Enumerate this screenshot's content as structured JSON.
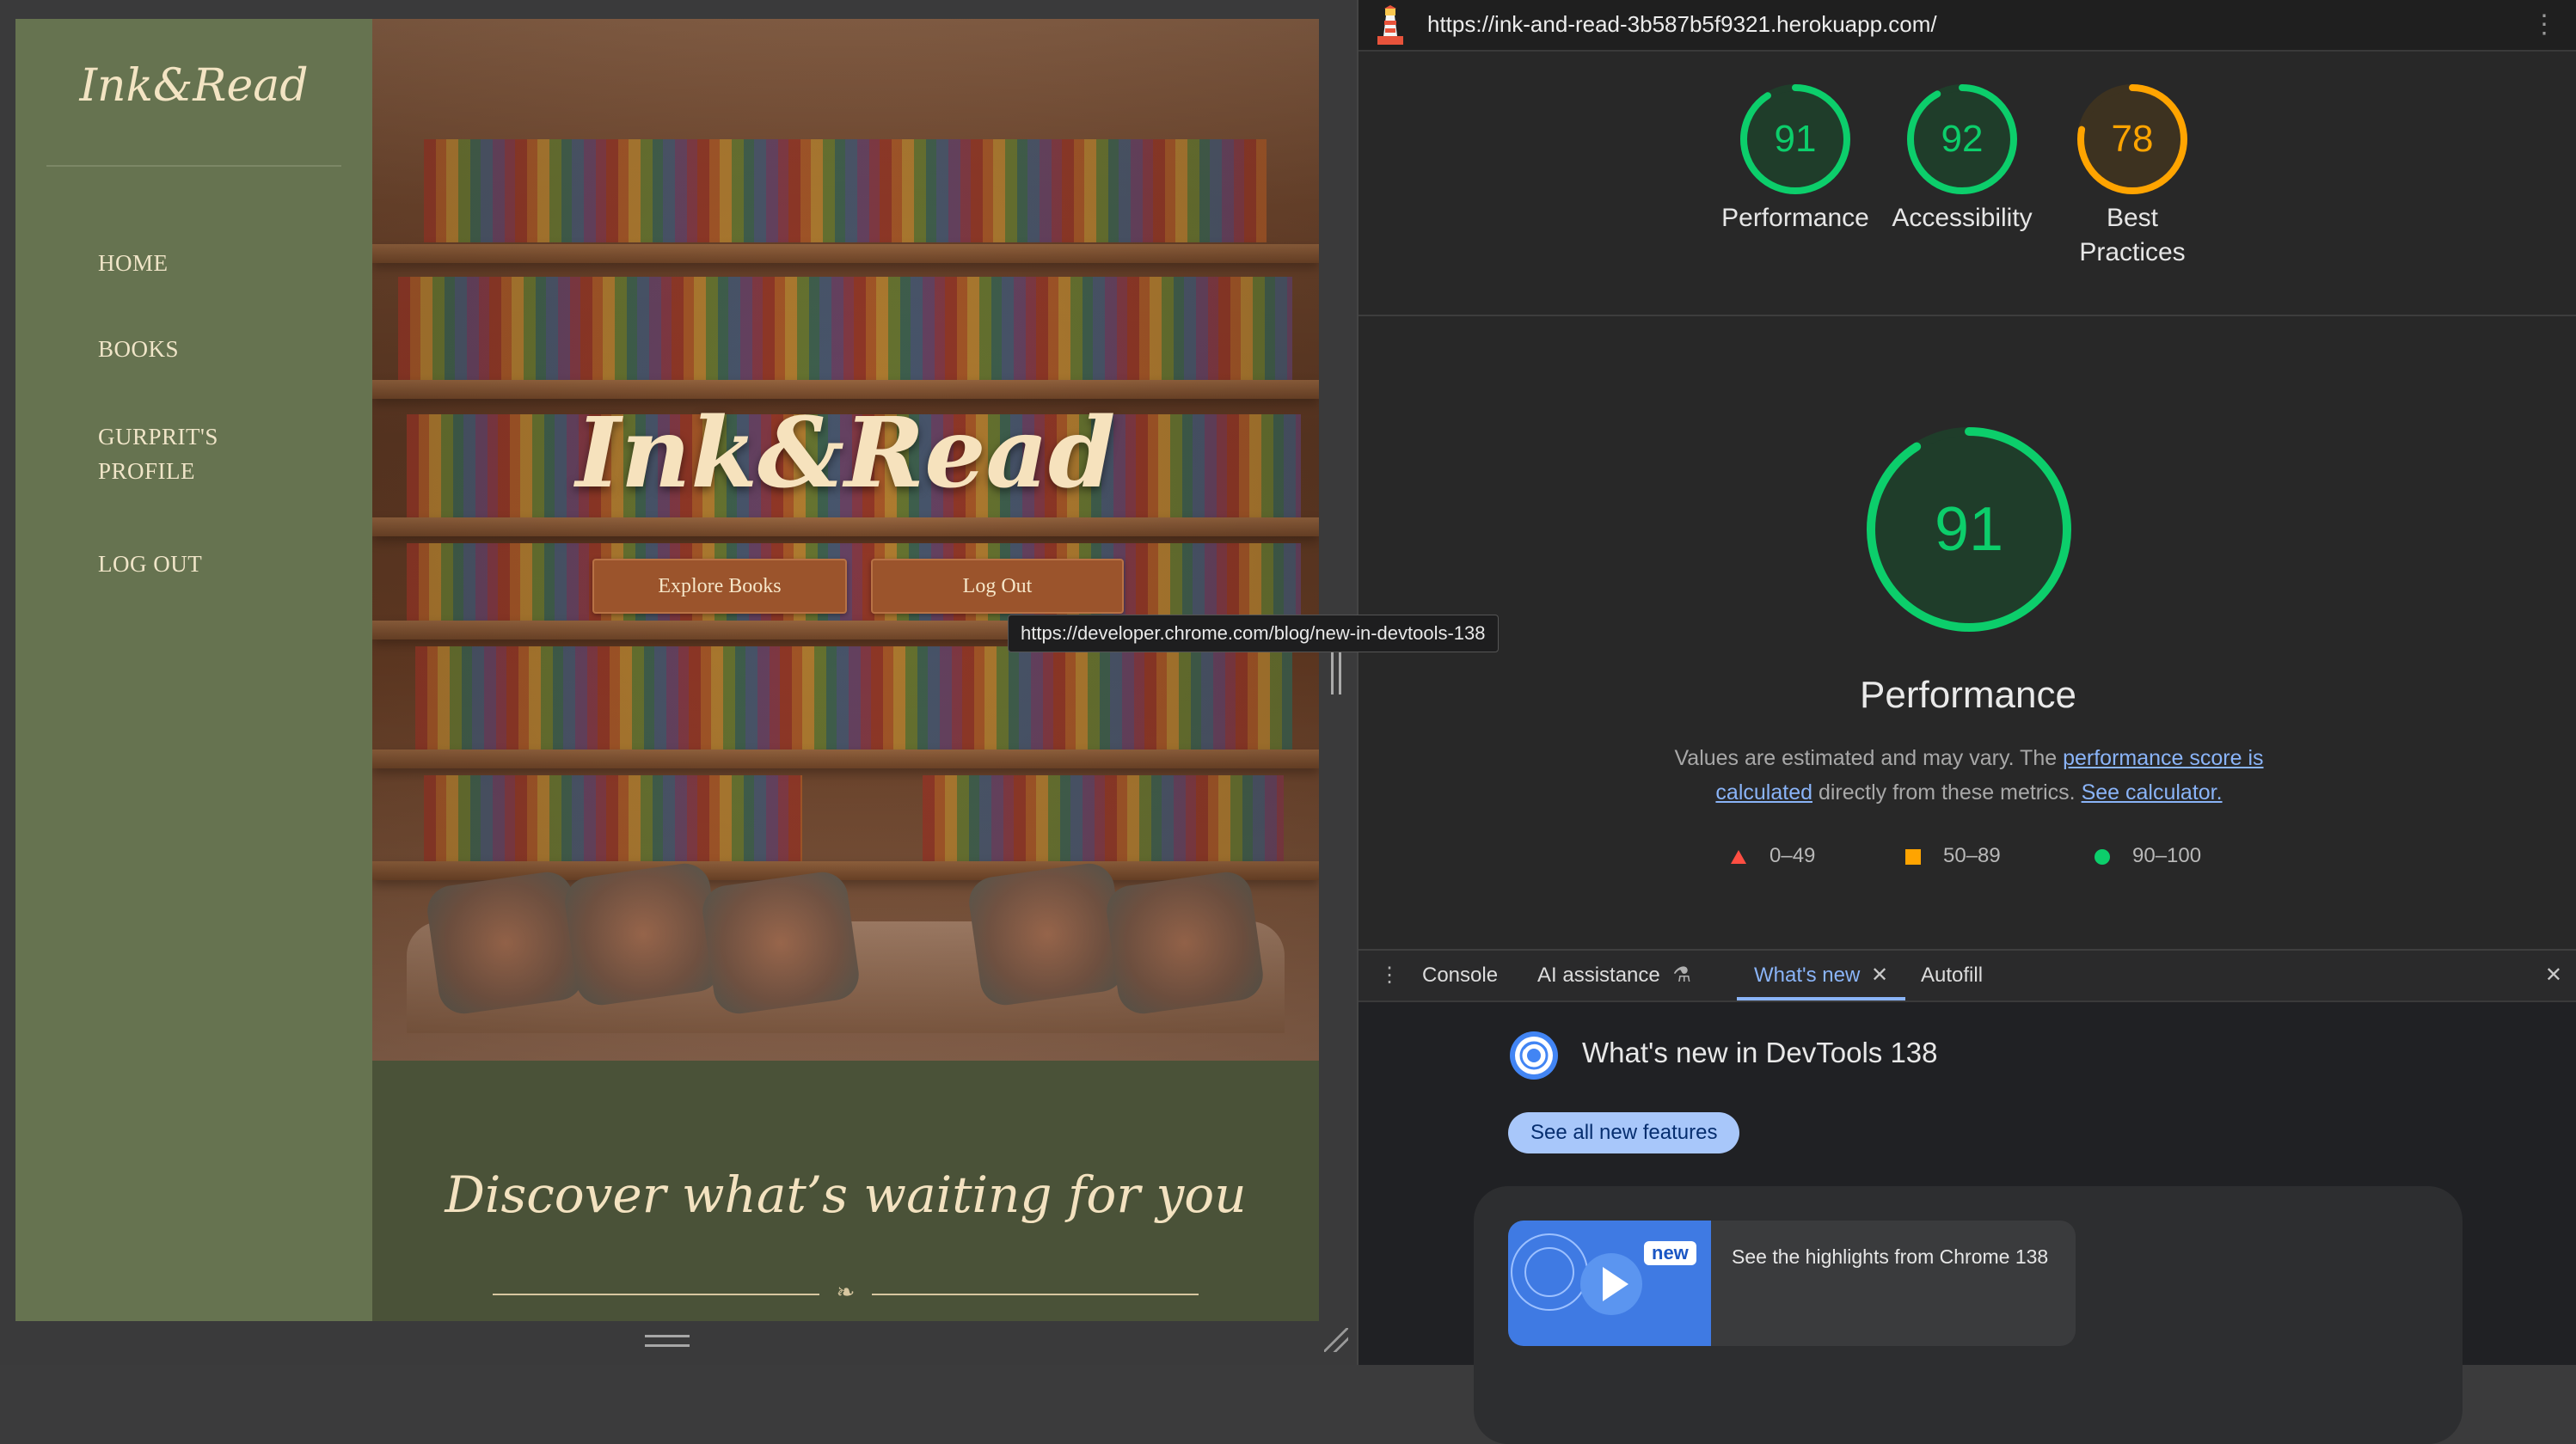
{
  "site": {
    "logo": "Ink&Read",
    "nav": [
      {
        "label": "HOME"
      },
      {
        "label": "BOOKS"
      },
      {
        "label": "GURPRIT'S",
        "label2": "PROFILE"
      },
      {
        "label": "LOG OUT"
      }
    ],
    "hero_title": "Ink&Read",
    "buttons": {
      "explore": "Explore Books",
      "logout": "Log Out"
    },
    "discover_title": "Discover what’s waiting for you",
    "ornament": "❧"
  },
  "tooltip": "https://developer.chrome.com/blog/new-in-devtools-138",
  "lighthouse": {
    "url": "https://ink-and-read-3b587b5f9321.herokuapp.com/",
    "menu_icon": "⋮",
    "scores": [
      {
        "label": "Performance",
        "value": "91",
        "score": 91,
        "color": "#0cce6b"
      },
      {
        "label": "Accessibility",
        "value": "92",
        "score": 92,
        "color": "#0cce6b"
      },
      {
        "label": "Best Practices",
        "value": "78",
        "score": 78,
        "color": "#ffa400"
      }
    ],
    "main": {
      "value": "91",
      "score": 91,
      "title": "Performance",
      "desc_prefix": "Values are estimated and may vary. The ",
      "desc_link1": "performance score is calculated",
      "desc_middle": " directly from these metrics. ",
      "desc_link2": "See calculator."
    },
    "legend": [
      {
        "label": "0–49",
        "shape": "triangle",
        "color": "#ff4e42"
      },
      {
        "label": "50–89",
        "shape": "square",
        "color": "#ffa400"
      },
      {
        "label": "90–100",
        "shape": "circle",
        "color": "#0cce6b"
      }
    ]
  },
  "drawer": {
    "menu_icon": "⋮",
    "tabs": {
      "console": "Console",
      "ai": "AI assistance",
      "ai_icon": "⚗",
      "whatsnew": "What's new",
      "autofill": "Autofill"
    },
    "close_tab_icon": "✕",
    "close_icon": "✕",
    "heading": "What's new in DevTools 138",
    "see_all": "See all new features",
    "item_badge": "new",
    "item_text": "See the highlights from Chrome 138"
  }
}
